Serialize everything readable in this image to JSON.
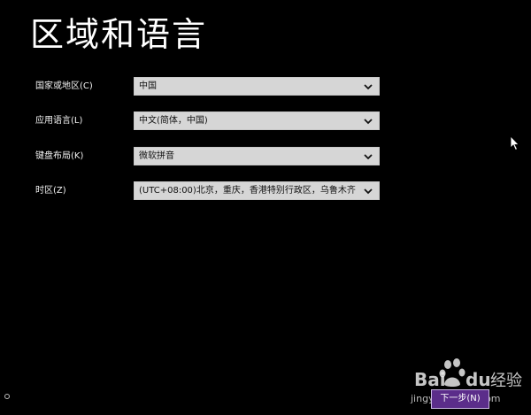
{
  "page": {
    "title": "区域和语言"
  },
  "fields": [
    {
      "label": "国家或地区(C)",
      "value": "中国"
    },
    {
      "label": "应用语言(L)",
      "value": "中文(简体，中国)"
    },
    {
      "label": "键盘布局(K)",
      "value": "微软拼音"
    },
    {
      "label": "时区(Z)",
      "value": "(UTC+08:00)北京，重庆，香港特别行政区，乌鲁木齐"
    }
  ],
  "next_button": {
    "label": "下一步(N)"
  },
  "watermark": {
    "brand": "Baidu经验",
    "url": "jingyan.baidu.com"
  },
  "icons": {
    "chevron": "chevron-down-icon",
    "cursor": "mouse-pointer-icon",
    "accessibility": "ease-of-access-icon"
  },
  "colors": {
    "background": "#000000",
    "field_bg": "#d6d6d6",
    "button_bg": "#5b2d8a"
  }
}
